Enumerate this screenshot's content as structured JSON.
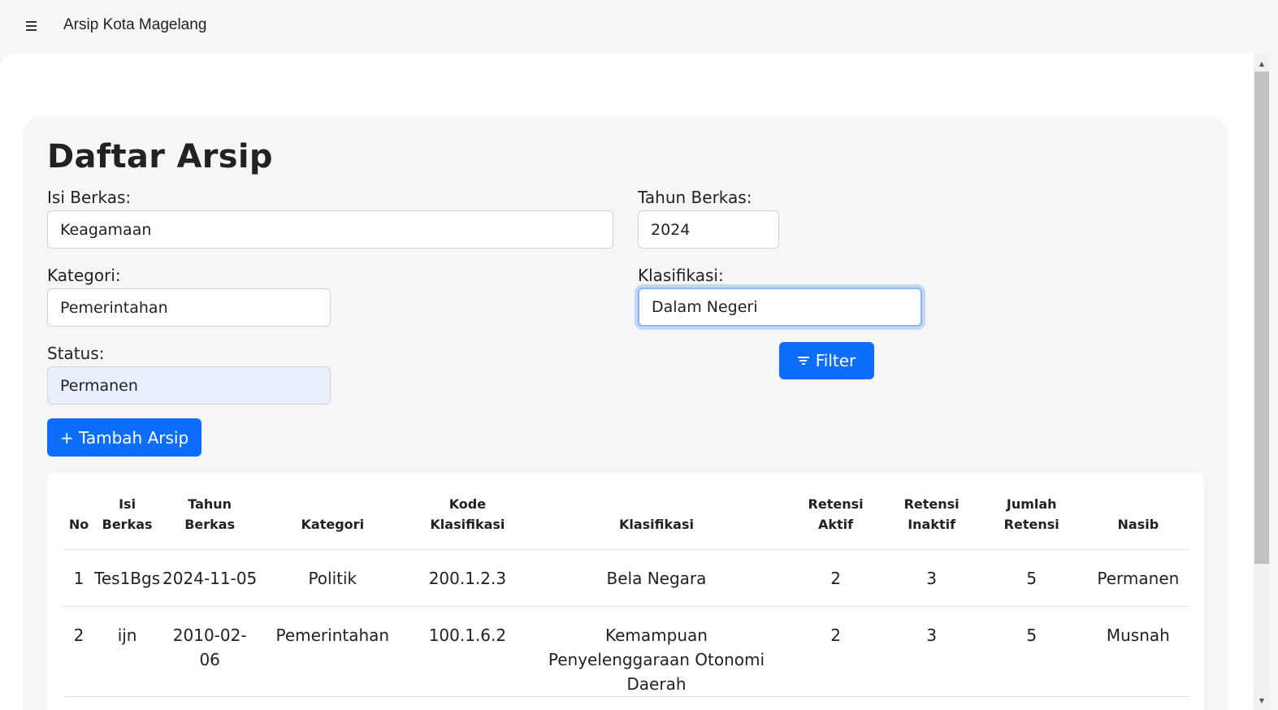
{
  "header": {
    "menu_icon": "hamburger-menu-icon",
    "title": "Arsip Kota Magelang"
  },
  "page": {
    "title": "Daftar Arsip"
  },
  "filters": {
    "isi_berkas": {
      "label": "Isi Berkas:",
      "value": "Keagamaan"
    },
    "tahun_berkas": {
      "label": "Tahun Berkas:",
      "value": "2024"
    },
    "kategori": {
      "label": "Kategori:",
      "value": "Pemerintahan"
    },
    "klasifikasi": {
      "label": "Klasifikasi:",
      "value": "Dalam Negeri"
    },
    "status": {
      "label": "Status:",
      "value": "Permanen"
    },
    "filter_button": "Filter",
    "filter_icon": "filter-icon"
  },
  "actions": {
    "add_button": "+ Tambah Arsip"
  },
  "table": {
    "columns": [
      "No",
      "Isi Berkas",
      "Tahun Berkas",
      "Kategori",
      "Kode Klasifikasi",
      "Klasifikasi",
      "Retensi Aktif",
      "Retensi Inaktif",
      "Jumlah Retensi",
      "Nasib"
    ],
    "rows": [
      [
        "1",
        "Tes1Bgs",
        "2024-11-05",
        "Politik",
        "200.1.2.3",
        "Bela Negara",
        "2",
        "3",
        "5",
        "Permanen"
      ],
      [
        "2",
        "ijn",
        "2010-02-06",
        "Pemerintahan",
        "100.1.6.2",
        "Kemampuan Penyelenggaraan Otonomi Daerah",
        "2",
        "3",
        "5",
        "Musnah"
      ]
    ]
  },
  "colors": {
    "primary": "#0d6efd",
    "focus_ring": "#86b7fe",
    "autofill": "#e8f0fe"
  }
}
